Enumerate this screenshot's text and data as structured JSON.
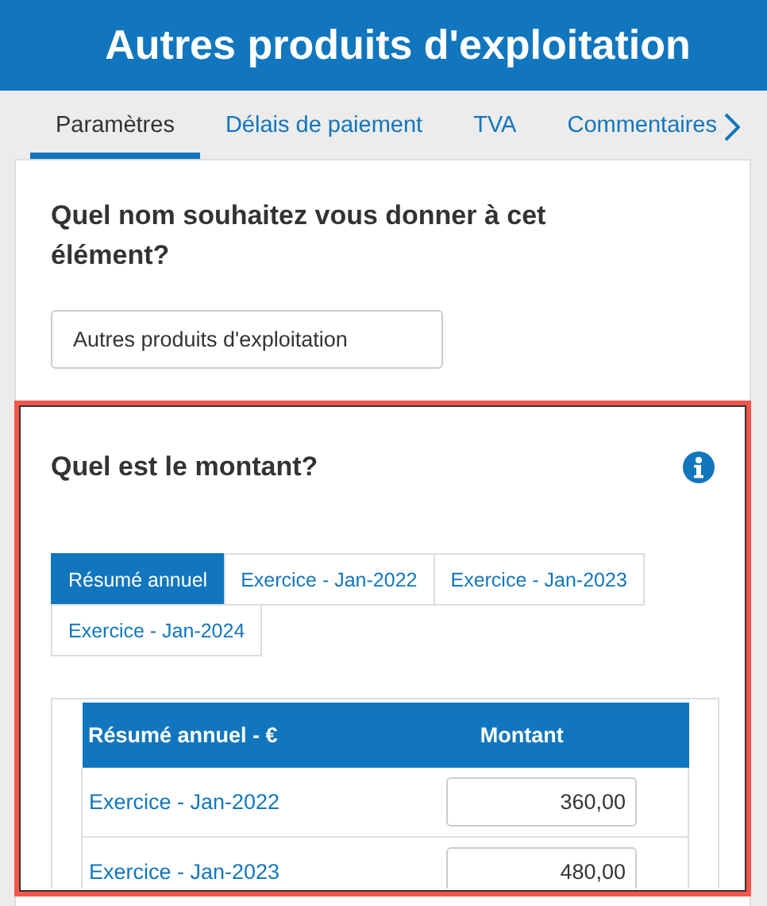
{
  "header": {
    "title": "Autres produits d'exploitation"
  },
  "tabs": [
    {
      "label": "Paramètres",
      "selected": true
    },
    {
      "label": "Délais de paiement",
      "selected": false
    },
    {
      "label": "TVA",
      "selected": false
    },
    {
      "label": "Commentaires",
      "selected": false
    }
  ],
  "name_section": {
    "question": "Quel nom souhaitez vous donner à cet élément?",
    "value": "Autres produits d'exploitation"
  },
  "amount_section": {
    "question": "Quel est le montant?",
    "highlighted": true,
    "period_tabs": [
      {
        "label": "Résumé annuel",
        "selected": true
      },
      {
        "label": "Exercice - Jan-2022",
        "selected": false
      },
      {
        "label": "Exercice - Jan-2023",
        "selected": false
      },
      {
        "label": "Exercice - Jan-2024",
        "selected": false
      }
    ],
    "table": {
      "columns": [
        "Résumé annuel - €",
        "Montant"
      ],
      "rows": [
        {
          "period": "Exercice - Jan-2022",
          "amount": "360,00"
        },
        {
          "period": "Exercice - Jan-2023",
          "amount": "480,00"
        }
      ]
    }
  }
}
